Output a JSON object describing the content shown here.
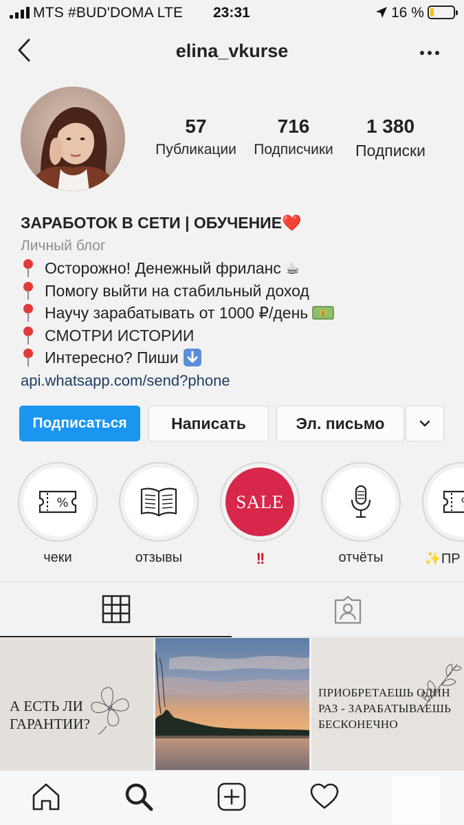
{
  "status_bar": {
    "carrier": "MTS #BUD'DOMA LTE",
    "time": "23:31",
    "battery_percent": "16 %",
    "battery_level": 0.16
  },
  "header": {
    "username": "elina_vkurse",
    "back_icon": "chevron-left-icon",
    "more_icon": "more-horizontal-icon"
  },
  "profile": {
    "stats": [
      {
        "value": "57",
        "label": "Публикации"
      },
      {
        "value": "716",
        "label": "Подписчики"
      },
      {
        "value": "1 380",
        "label": "Подписки"
      }
    ],
    "bio": {
      "name": "ЗАРАБОТОК В СЕТИ | ОБУЧЕНИЕ❤️",
      "category": "Личный блог",
      "lines": [
        "Осторожно! Денежный фриланс ☕",
        "Помогу выйти на стабильный доход",
        "Научу зарабатывать от 1000 ₽/день",
        "СМОТРИ ИСТОРИИ",
        "Интересно? Пиши"
      ],
      "link": "api.whatsapp.com/send?phone"
    }
  },
  "actions": {
    "follow": "Подписаться",
    "message": "Написать",
    "email": "Эл. письмо",
    "more_icon": "chevron-down-icon"
  },
  "highlights": [
    {
      "label": "чеки",
      "icon": "receipt-percent-icon"
    },
    {
      "label": "отзывы",
      "icon": "open-book-icon"
    },
    {
      "label": "!!",
      "cover_text": "SALE"
    },
    {
      "label": "отчёты",
      "icon": "microphone-icon"
    },
    {
      "label": "✨ПР",
      "icon": "receipt-percent-icon"
    }
  ],
  "tabs": [
    {
      "name": "grid",
      "icon": "grid-icon",
      "active": true
    },
    {
      "name": "tagged",
      "icon": "tagged-person-icon",
      "active": false
    }
  ],
  "posts": [
    {
      "text": "А ЕСТЬ ЛИ ГАРАНТИИ?"
    },
    {
      "image": "sunset-lake-photo"
    },
    {
      "text": "ПРИОБРЕТАЕШЬ ОДИН РАЗ - ЗАРАБАТЫВАЕШЬ БЕСКОНЕЧНО"
    }
  ],
  "bottom_nav": [
    {
      "icon": "home-icon"
    },
    {
      "icon": "search-icon"
    },
    {
      "icon": "add-post-icon"
    },
    {
      "icon": "heart-icon"
    }
  ],
  "colors": {
    "follow_button": "#1a95f0",
    "sale_highlight": "#d7274a",
    "link": "#1c3d64",
    "background": "#f2f2f2"
  }
}
